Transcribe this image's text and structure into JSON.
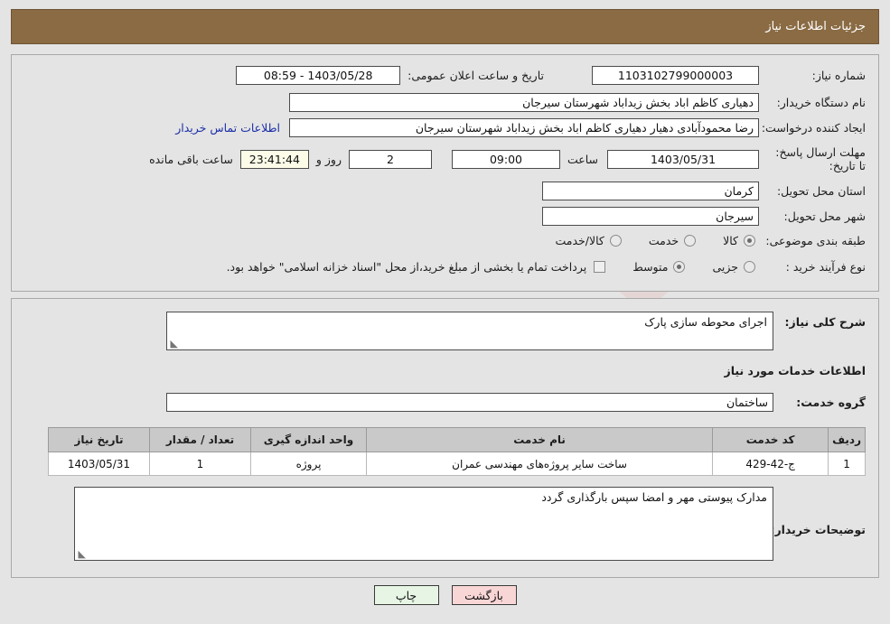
{
  "header": {
    "title": "جزئیات اطلاعات نیاز",
    "bar_color": "#8a6b44"
  },
  "summary": {
    "need_number_label": "شماره نیاز:",
    "need_number_value": "1103102799000003",
    "announce_label": "تاریخ و ساعت اعلان عمومی:",
    "announce_value": "1403/05/28 - 08:59",
    "buyer_org_label": "نام دستگاه خریدار:",
    "buyer_org_value": "دهیاری کاظم اباد بخش زیداباد شهرستان سیرجان",
    "creator_label": "ایجاد کننده درخواست:",
    "creator_value": "رضا محمودآبادی دهیار دهیاری کاظم اباد بخش زیداباد شهرستان سیرجان",
    "contact_link": "اطلاعات تماس خریدار",
    "deadline_label": "مهلت ارسال پاسخ: تا تاریخ:",
    "deadline_date": "1403/05/31",
    "deadline_time_label": "ساعت",
    "deadline_time": "09:00",
    "remaining_days": "2",
    "remaining_days_label": "روز و",
    "remaining_clock": "23:41:44",
    "remaining_suffix": "ساعت باقی مانده",
    "province_label": "استان محل تحویل:",
    "province_value": "کرمان",
    "city_label": "شهر محل تحویل:",
    "city_value": "سیرجان",
    "category_label": "طبقه بندی موضوعی:",
    "category_options": [
      {
        "label": "کالا",
        "selected": true
      },
      {
        "label": "خدمت",
        "selected": false
      },
      {
        "label": "کالا/خدمت",
        "selected": false
      }
    ],
    "process_label": "نوع فرآیند خرید :",
    "process_options": [
      {
        "label": "جزیی",
        "selected": false
      },
      {
        "label": "متوسط",
        "selected": true
      }
    ],
    "treasury_checked": false,
    "treasury_note": "پرداخت تمام یا بخشی از مبلغ خرید،از محل \"اسناد خزانه اسلامی\" خواهد بود."
  },
  "details": {
    "general_desc_label": "شرح کلی نیاز:",
    "general_desc_value": "اجرای محوطه سازی پارک",
    "services_section_title": "اطلاعات خدمات مورد نیاز",
    "service_group_label": "گروه خدمت:",
    "service_group_value": "ساختمان",
    "table": {
      "headers": [
        "ردیف",
        "کد خدمت",
        "نام خدمت",
        "واحد اندازه گیری",
        "تعداد / مقدار",
        "تاریخ نیاز"
      ],
      "rows": [
        {
          "row_no": "1",
          "service_code": "ج-42-429",
          "service_name": "ساخت سایر پروژه‌های مهندسی عمران",
          "unit": "پروژه",
          "quantity": "1",
          "need_date": "1403/05/31"
        }
      ]
    },
    "buyer_notes_label": "توضیحات خریدار:",
    "buyer_notes_value": "مدارک پیوستی مهر و امضا سپس بارگذاری گردد"
  },
  "buttons": {
    "print": "چاپ",
    "back": "بازگشت"
  },
  "watermark": {
    "text": "AnaTender.net"
  }
}
